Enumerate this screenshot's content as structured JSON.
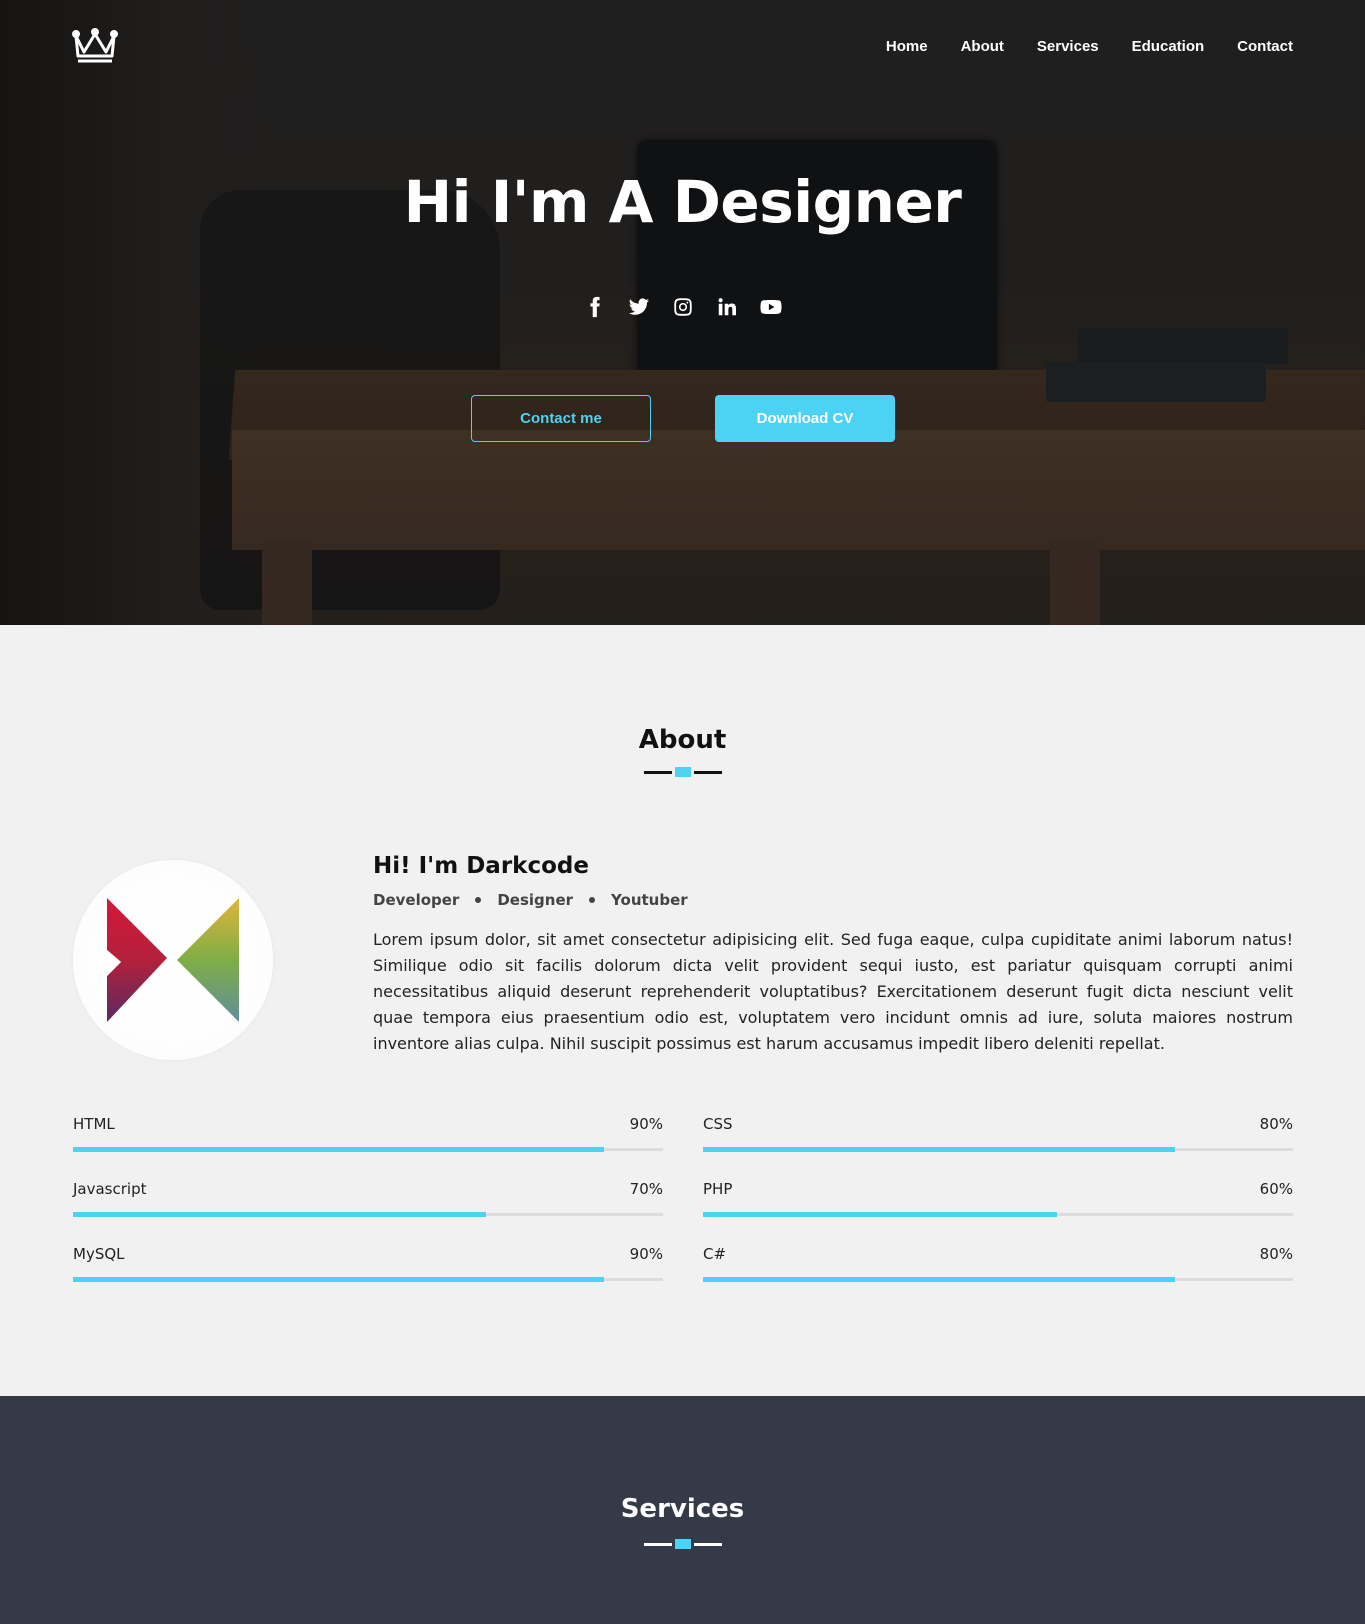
{
  "nav": {
    "logo_icon": "crown-icon",
    "items": [
      {
        "label": "Home"
      },
      {
        "label": "About"
      },
      {
        "label": "Services"
      },
      {
        "label": "Education"
      },
      {
        "label": "Contact"
      }
    ]
  },
  "hero": {
    "title": "Hi I'm A Designer",
    "socials": [
      "facebook-icon",
      "twitter-icon",
      "instagram-icon",
      "linkedin-icon",
      "youtube-icon"
    ],
    "contact_button": "Contact me",
    "download_button": "Download CV"
  },
  "about": {
    "title": "About",
    "name": "Hi! I'm Darkcode",
    "roles": [
      "Developer",
      "Designer",
      "Youtuber"
    ],
    "description": "Lorem ipsum dolor, sit amet consectetur adipisicing elit. Sed fuga eaque, culpa cupiditate animi laborum natus! Similique odio sit facilis dolorum dicta velit provident sequi iusto, est pariatur quisquam corrupti animi necessitatibus aliquid deserunt reprehenderit voluptatibus? Exercitationem deserunt fugit dicta nesciunt velit quae tempora eius praesentium odio est, voluptatem vero incidunt omnis ad iure, soluta maiores nostrum inventore alias culpa. Nihil suscipit possimus est harum accusamus impedit libero deleniti repellat.",
    "skills": [
      {
        "name": "HTML",
        "percent_label": "90%",
        "level": 0.9
      },
      {
        "name": "CSS",
        "percent_label": "80%",
        "level": 0.8
      },
      {
        "name": "Javascript",
        "percent_label": "70%",
        "level": 0.7
      },
      {
        "name": "PHP",
        "percent_label": "60%",
        "level": 0.6
      },
      {
        "name": "MySQL",
        "percent_label": "90%",
        "level": 0.9
      },
      {
        "name": "C#",
        "percent_label": "80%",
        "level": 0.8
      }
    ]
  },
  "services": {
    "title": "Services"
  },
  "colors": {
    "accent": "#4cd3f3",
    "services_bg": "#343a48",
    "about_bg": "#f1f1f1"
  }
}
